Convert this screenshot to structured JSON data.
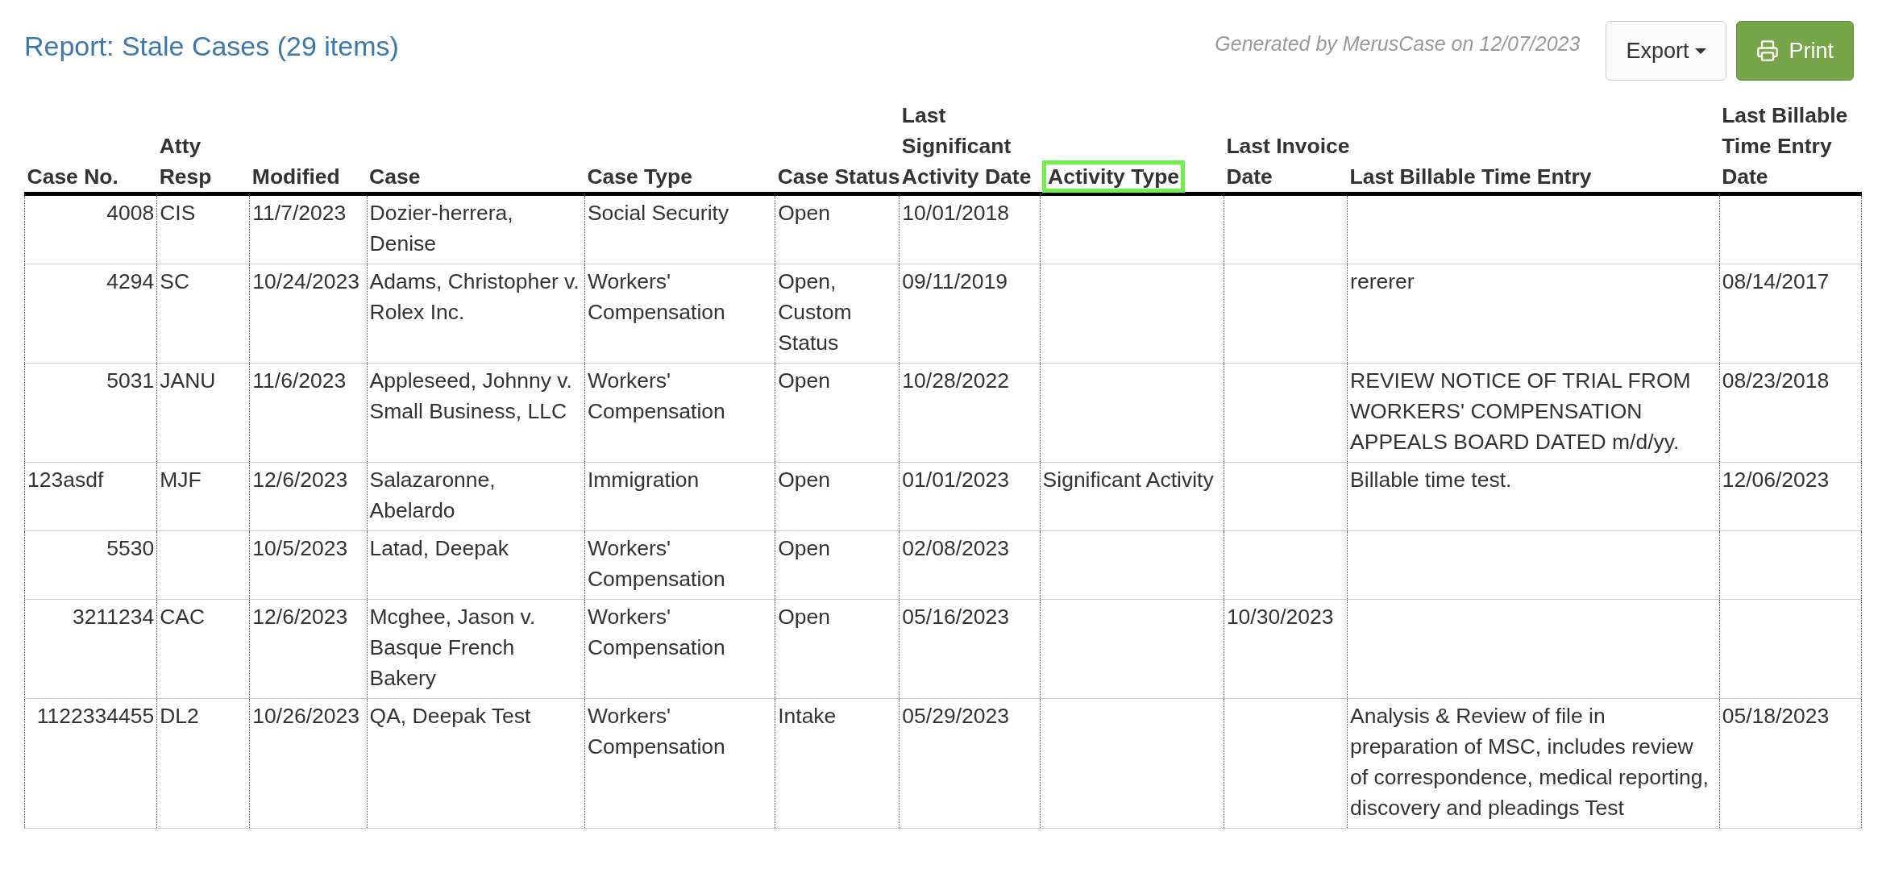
{
  "report": {
    "title": "Report: Stale Cases (29 items)",
    "generated": "Generated by MerusCase on 12/07/2023"
  },
  "buttons": [
    {
      "kind": "export",
      "label": "Export"
    },
    {
      "kind": "print",
      "label": "Print"
    }
  ],
  "table": {
    "columns": [
      {
        "lines": [
          "Case No."
        ],
        "highlighted": false
      },
      {
        "lines": [
          "Atty",
          "Resp"
        ],
        "highlighted": false
      },
      {
        "lines": [
          "Modified"
        ],
        "highlighted": false
      },
      {
        "lines": [
          "Case"
        ],
        "highlighted": false
      },
      {
        "lines": [
          "Case Type"
        ],
        "highlighted": false
      },
      {
        "lines": [
          "Case Status"
        ],
        "highlighted": false
      },
      {
        "lines": [
          "Last",
          "Significant",
          "Activity Date"
        ],
        "highlighted": false
      },
      {
        "lines": [
          "Activity Type"
        ],
        "highlighted": true
      },
      {
        "lines": [
          "Last Invoice",
          "Date"
        ],
        "highlighted": false
      },
      {
        "lines": [
          "Last Billable Time Entry"
        ],
        "highlighted": false
      },
      {
        "lines": [
          "Last Billable",
          "Time Entry",
          "Date"
        ],
        "highlighted": false
      }
    ],
    "rows": [
      {
        "numeric": true,
        "cells": [
          "4008",
          "CIS",
          "11/7/2023",
          "Dozier-herrera, Denise",
          "Social Security",
          "Open",
          "10/01/2018",
          "",
          "",
          "",
          ""
        ]
      },
      {
        "numeric": true,
        "cells": [
          "4294",
          "SC",
          "10/24/2023",
          "Adams, Christopher v. Rolex Inc.",
          "Workers' Compensation",
          "Open, Custom Status",
          "09/11/2019",
          "",
          "",
          "rererer",
          "08/14/2017"
        ]
      },
      {
        "numeric": true,
        "cells": [
          "5031",
          "JANU",
          "11/6/2023",
          "Appleseed, Johnny v. Small Business, LLC",
          "Workers' Compensation",
          "Open",
          "10/28/2022",
          "",
          "",
          "REVIEW NOTICE OF TRIAL FROM WORKERS' COMPENSATION APPEALS BOARD DATED m/d/yy.",
          "08/23/2018"
        ]
      },
      {
        "numeric": false,
        "cells": [
          "123asdf",
          "MJF",
          "12/6/2023",
          "Salazaronne, Abelardo",
          "Immigration",
          "Open",
          "01/01/2023",
          "Significant Activity",
          "",
          "Billable time test.",
          "12/06/2023"
        ]
      },
      {
        "numeric": true,
        "cells": [
          "5530",
          "",
          "10/5/2023",
          "Latad, Deepak",
          "Workers' Compensation",
          "Open",
          "02/08/2023",
          "",
          "",
          "",
          ""
        ]
      },
      {
        "numeric": true,
        "cells": [
          "3211234",
          "CAC",
          "12/6/2023",
          "Mcghee, Jason v. Basque French Bakery",
          "Workers' Compensation",
          "Open",
          "05/16/2023",
          "",
          "10/30/2023",
          "",
          ""
        ]
      },
      {
        "numeric": true,
        "cells": [
          "1122334455",
          "DL2",
          "10/26/2023",
          "QA, Deepak Test",
          "Workers' Compensation",
          "Intake",
          "05/29/2023",
          "",
          "",
          "Analysis & Review of file in preparation of MSC, includes review of correspondence, medical reporting, discovery and pleadings Test",
          "05/18/2023"
        ]
      }
    ]
  }
}
